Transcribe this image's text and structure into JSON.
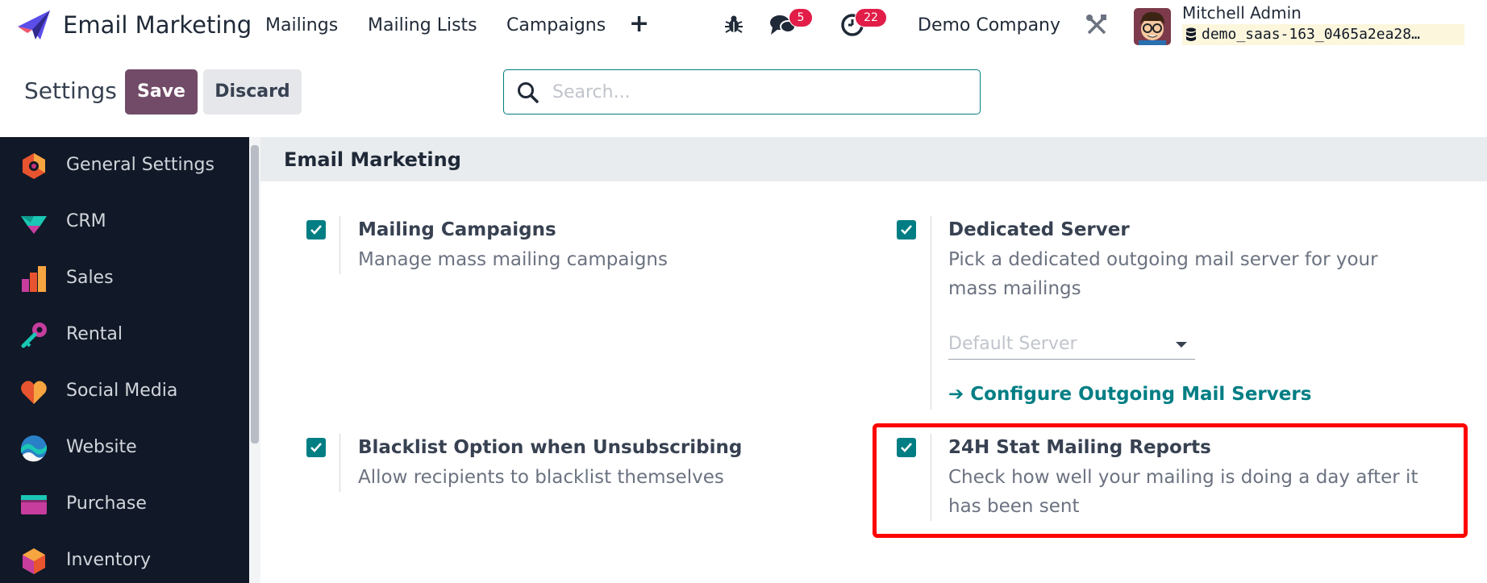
{
  "app": {
    "title": "Email Marketing"
  },
  "nav": {
    "items": [
      "Mailings",
      "Mailing Lists",
      "Campaigns"
    ],
    "add_symbol": "+"
  },
  "systray": {
    "messages_count": "5",
    "activities_count": "22",
    "company": "Demo Company",
    "user_name": "Mitchell Admin",
    "database": "demo_saas-163_0465a2ea28…"
  },
  "control_panel": {
    "title": "Settings",
    "save_label": "Save",
    "discard_label": "Discard",
    "search_placeholder": "Search..."
  },
  "sidebar": {
    "items": [
      {
        "label": "General Settings",
        "icon": "general-settings-icon"
      },
      {
        "label": "CRM",
        "icon": "crm-icon"
      },
      {
        "label": "Sales",
        "icon": "sales-icon"
      },
      {
        "label": "Rental",
        "icon": "rental-icon"
      },
      {
        "label": "Social Media",
        "icon": "social-media-icon"
      },
      {
        "label": "Website",
        "icon": "website-icon"
      },
      {
        "label": "Purchase",
        "icon": "purchase-icon"
      },
      {
        "label": "Inventory",
        "icon": "inventory-icon"
      }
    ]
  },
  "section": {
    "title": "Email Marketing",
    "settings": [
      {
        "title": "Mailing Campaigns",
        "description": "Manage mass mailing campaigns",
        "checked": true
      },
      {
        "title": "Dedicated Server",
        "description": "Pick a dedicated outgoing mail server for your mass mailings",
        "checked": true
      },
      {
        "title": "Blacklist Option when Unsubscribing",
        "description": "Allow recipients to blacklist themselves",
        "checked": true
      },
      {
        "title": "24H Stat Mailing Reports",
        "description": "Check how well your mailing is doing a day after it has been sent",
        "checked": true
      }
    ],
    "server_select_placeholder": "Default Server",
    "configure_link": "➔ Configure Outgoing Mail Servers"
  },
  "colors": {
    "brand": "#714b67",
    "accent": "#017e84",
    "sidebar_bg": "#111827",
    "badge": "#e11d48",
    "highlight": "#ff0000"
  }
}
